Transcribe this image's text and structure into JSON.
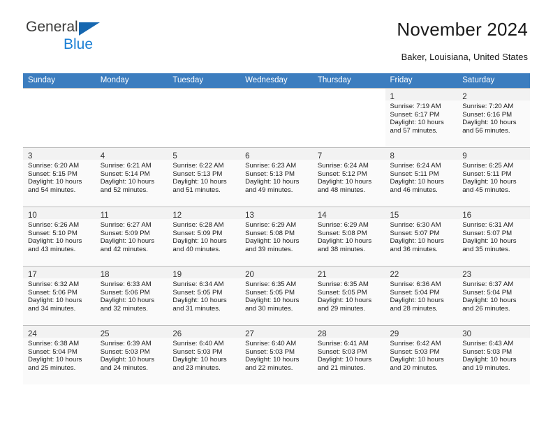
{
  "brand": {
    "name_part1": "General",
    "name_part2": "Blue",
    "accent_color": "#1b7fd4",
    "triangle_color": "#1667b0"
  },
  "header": {
    "title": "November 2024",
    "location": "Baker, Louisiana, United States"
  },
  "calendar": {
    "header_background": "#3c7dbf",
    "weekday_headers": [
      "Sunday",
      "Monday",
      "Tuesday",
      "Wednesday",
      "Thursday",
      "Friday",
      "Saturday"
    ],
    "labels": {
      "sunrise": "Sunrise:",
      "sunset": "Sunset:",
      "daylight": "Daylight:"
    },
    "weeks": [
      [
        {
          "day": "",
          "lines": []
        },
        {
          "day": "",
          "lines": []
        },
        {
          "day": "",
          "lines": []
        },
        {
          "day": "",
          "lines": []
        },
        {
          "day": "",
          "lines": []
        },
        {
          "day": "1",
          "lines": [
            "Sunrise: 7:19 AM",
            "Sunset: 6:17 PM",
            "Daylight: 10 hours",
            "and 57 minutes."
          ]
        },
        {
          "day": "2",
          "lines": [
            "Sunrise: 7:20 AM",
            "Sunset: 6:16 PM",
            "Daylight: 10 hours",
            "and 56 minutes."
          ]
        }
      ],
      [
        {
          "day": "3",
          "lines": [
            "Sunrise: 6:20 AM",
            "Sunset: 5:15 PM",
            "Daylight: 10 hours",
            "and 54 minutes."
          ]
        },
        {
          "day": "4",
          "lines": [
            "Sunrise: 6:21 AM",
            "Sunset: 5:14 PM",
            "Daylight: 10 hours",
            "and 52 minutes."
          ]
        },
        {
          "day": "5",
          "lines": [
            "Sunrise: 6:22 AM",
            "Sunset: 5:13 PM",
            "Daylight: 10 hours",
            "and 51 minutes."
          ]
        },
        {
          "day": "6",
          "lines": [
            "Sunrise: 6:23 AM",
            "Sunset: 5:13 PM",
            "Daylight: 10 hours",
            "and 49 minutes."
          ]
        },
        {
          "day": "7",
          "lines": [
            "Sunrise: 6:24 AM",
            "Sunset: 5:12 PM",
            "Daylight: 10 hours",
            "and 48 minutes."
          ]
        },
        {
          "day": "8",
          "lines": [
            "Sunrise: 6:24 AM",
            "Sunset: 5:11 PM",
            "Daylight: 10 hours",
            "and 46 minutes."
          ]
        },
        {
          "day": "9",
          "lines": [
            "Sunrise: 6:25 AM",
            "Sunset: 5:11 PM",
            "Daylight: 10 hours",
            "and 45 minutes."
          ]
        }
      ],
      [
        {
          "day": "10",
          "lines": [
            "Sunrise: 6:26 AM",
            "Sunset: 5:10 PM",
            "Daylight: 10 hours",
            "and 43 minutes."
          ]
        },
        {
          "day": "11",
          "lines": [
            "Sunrise: 6:27 AM",
            "Sunset: 5:09 PM",
            "Daylight: 10 hours",
            "and 42 minutes."
          ]
        },
        {
          "day": "12",
          "lines": [
            "Sunrise: 6:28 AM",
            "Sunset: 5:09 PM",
            "Daylight: 10 hours",
            "and 40 minutes."
          ]
        },
        {
          "day": "13",
          "lines": [
            "Sunrise: 6:29 AM",
            "Sunset: 5:08 PM",
            "Daylight: 10 hours",
            "and 39 minutes."
          ]
        },
        {
          "day": "14",
          "lines": [
            "Sunrise: 6:29 AM",
            "Sunset: 5:08 PM",
            "Daylight: 10 hours",
            "and 38 minutes."
          ]
        },
        {
          "day": "15",
          "lines": [
            "Sunrise: 6:30 AM",
            "Sunset: 5:07 PM",
            "Daylight: 10 hours",
            "and 36 minutes."
          ]
        },
        {
          "day": "16",
          "lines": [
            "Sunrise: 6:31 AM",
            "Sunset: 5:07 PM",
            "Daylight: 10 hours",
            "and 35 minutes."
          ]
        }
      ],
      [
        {
          "day": "17",
          "lines": [
            "Sunrise: 6:32 AM",
            "Sunset: 5:06 PM",
            "Daylight: 10 hours",
            "and 34 minutes."
          ]
        },
        {
          "day": "18",
          "lines": [
            "Sunrise: 6:33 AM",
            "Sunset: 5:06 PM",
            "Daylight: 10 hours",
            "and 32 minutes."
          ]
        },
        {
          "day": "19",
          "lines": [
            "Sunrise: 6:34 AM",
            "Sunset: 5:05 PM",
            "Daylight: 10 hours",
            "and 31 minutes."
          ]
        },
        {
          "day": "20",
          "lines": [
            "Sunrise: 6:35 AM",
            "Sunset: 5:05 PM",
            "Daylight: 10 hours",
            "and 30 minutes."
          ]
        },
        {
          "day": "21",
          "lines": [
            "Sunrise: 6:35 AM",
            "Sunset: 5:05 PM",
            "Daylight: 10 hours",
            "and 29 minutes."
          ]
        },
        {
          "day": "22",
          "lines": [
            "Sunrise: 6:36 AM",
            "Sunset: 5:04 PM",
            "Daylight: 10 hours",
            "and 28 minutes."
          ]
        },
        {
          "day": "23",
          "lines": [
            "Sunrise: 6:37 AM",
            "Sunset: 5:04 PM",
            "Daylight: 10 hours",
            "and 26 minutes."
          ]
        }
      ],
      [
        {
          "day": "24",
          "lines": [
            "Sunrise: 6:38 AM",
            "Sunset: 5:04 PM",
            "Daylight: 10 hours",
            "and 25 minutes."
          ]
        },
        {
          "day": "25",
          "lines": [
            "Sunrise: 6:39 AM",
            "Sunset: 5:03 PM",
            "Daylight: 10 hours",
            "and 24 minutes."
          ]
        },
        {
          "day": "26",
          "lines": [
            "Sunrise: 6:40 AM",
            "Sunset: 5:03 PM",
            "Daylight: 10 hours",
            "and 23 minutes."
          ]
        },
        {
          "day": "27",
          "lines": [
            "Sunrise: 6:40 AM",
            "Sunset: 5:03 PM",
            "Daylight: 10 hours",
            "and 22 minutes."
          ]
        },
        {
          "day": "28",
          "lines": [
            "Sunrise: 6:41 AM",
            "Sunset: 5:03 PM",
            "Daylight: 10 hours",
            "and 21 minutes."
          ]
        },
        {
          "day": "29",
          "lines": [
            "Sunrise: 6:42 AM",
            "Sunset: 5:03 PM",
            "Daylight: 10 hours",
            "and 20 minutes."
          ]
        },
        {
          "day": "30",
          "lines": [
            "Sunrise: 6:43 AM",
            "Sunset: 5:03 PM",
            "Daylight: 10 hours",
            "and 19 minutes."
          ]
        }
      ]
    ]
  }
}
